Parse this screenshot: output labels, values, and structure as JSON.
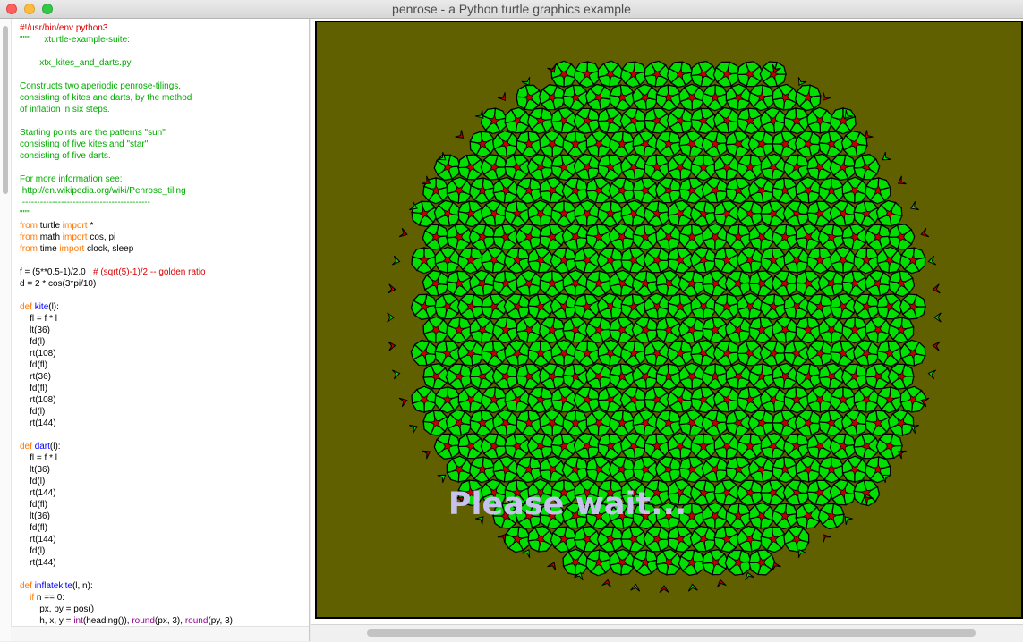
{
  "window": {
    "title": "penrose - a Python turtle graphics example"
  },
  "colors": {
    "canvas_background": "#606000",
    "kite_fill": "#00e000",
    "dart_fill": "#c00000",
    "outline": "#000000",
    "overlay_text": "#c6c2ee",
    "code_keyword": "#ff7700",
    "code_string": "#00aa00",
    "code_comment": "#dd0000",
    "code_defname": "#0000ff",
    "code_builtin": "#900090"
  },
  "editor": {
    "lines": [
      [
        {
          "t": "#!/usr/bin/env python3",
          "c": "cm"
        }
      ],
      [
        {
          "t": "\"\"\"      xturtle-example-suite:",
          "c": "st"
        }
      ],
      [
        {
          "t": "",
          "c": "st"
        }
      ],
      [
        {
          "t": "        xtx_kites_and_darts.py",
          "c": "st"
        }
      ],
      [
        {
          "t": "",
          "c": "st"
        }
      ],
      [
        {
          "t": "Constructs two aperiodic penrose-tilings,",
          "c": "st"
        }
      ],
      [
        {
          "t": "consisting of kites and darts, by the method",
          "c": "st"
        }
      ],
      [
        {
          "t": "of inflation in six steps.",
          "c": "st"
        }
      ],
      [
        {
          "t": "",
          "c": "st"
        }
      ],
      [
        {
          "t": "Starting points are the patterns \"sun\"",
          "c": "st"
        }
      ],
      [
        {
          "t": "consisting of five kites and \"star\"",
          "c": "st"
        }
      ],
      [
        {
          "t": "consisting of five darts.",
          "c": "st"
        }
      ],
      [
        {
          "t": "",
          "c": "st"
        }
      ],
      [
        {
          "t": "For more information see:",
          "c": "st"
        }
      ],
      [
        {
          "t": " http://en.wikipedia.org/wiki/Penrose_tiling",
          "c": "st"
        }
      ],
      [
        {
          "t": " -------------------------------------------",
          "c": "st"
        }
      ],
      [
        {
          "t": "\"\"\"",
          "c": "st"
        }
      ],
      [
        {
          "t": "from",
          "c": "kw"
        },
        {
          "t": " turtle ",
          "c": ""
        },
        {
          "t": "import",
          "c": "kw"
        },
        {
          "t": " *",
          "c": ""
        }
      ],
      [
        {
          "t": "from",
          "c": "kw"
        },
        {
          "t": " math ",
          "c": ""
        },
        {
          "t": "import",
          "c": "kw"
        },
        {
          "t": " cos, pi",
          "c": ""
        }
      ],
      [
        {
          "t": "from",
          "c": "kw"
        },
        {
          "t": " time ",
          "c": ""
        },
        {
          "t": "import",
          "c": "kw"
        },
        {
          "t": " clock, sleep",
          "c": ""
        }
      ],
      [
        {
          "t": "",
          "c": ""
        }
      ],
      [
        {
          "t": "f = (5**0.5-1)/2.0   ",
          "c": ""
        },
        {
          "t": "# (sqrt(5)-1)/2 -- golden ratio",
          "c": "cm"
        }
      ],
      [
        {
          "t": "d = 2 * cos(3*pi/10)",
          "c": ""
        }
      ],
      [
        {
          "t": "",
          "c": ""
        }
      ],
      [
        {
          "t": "def",
          "c": "kw"
        },
        {
          "t": " ",
          "c": ""
        },
        {
          "t": "kite",
          "c": "df"
        },
        {
          "t": "(l):",
          "c": ""
        }
      ],
      [
        {
          "t": "    fl = f * l",
          "c": ""
        }
      ],
      [
        {
          "t": "    lt(36)",
          "c": ""
        }
      ],
      [
        {
          "t": "    fd(l)",
          "c": ""
        }
      ],
      [
        {
          "t": "    rt(108)",
          "c": ""
        }
      ],
      [
        {
          "t": "    fd(fl)",
          "c": ""
        }
      ],
      [
        {
          "t": "    rt(36)",
          "c": ""
        }
      ],
      [
        {
          "t": "    fd(fl)",
          "c": ""
        }
      ],
      [
        {
          "t": "    rt(108)",
          "c": ""
        }
      ],
      [
        {
          "t": "    fd(l)",
          "c": ""
        }
      ],
      [
        {
          "t": "    rt(144)",
          "c": ""
        }
      ],
      [
        {
          "t": "",
          "c": ""
        }
      ],
      [
        {
          "t": "def",
          "c": "kw"
        },
        {
          "t": " ",
          "c": ""
        },
        {
          "t": "dart",
          "c": "df"
        },
        {
          "t": "(l):",
          "c": ""
        }
      ],
      [
        {
          "t": "    fl = f * l",
          "c": ""
        }
      ],
      [
        {
          "t": "    lt(36)",
          "c": ""
        }
      ],
      [
        {
          "t": "    fd(l)",
          "c": ""
        }
      ],
      [
        {
          "t": "    rt(144)",
          "c": ""
        }
      ],
      [
        {
          "t": "    fd(fl)",
          "c": ""
        }
      ],
      [
        {
          "t": "    lt(36)",
          "c": ""
        }
      ],
      [
        {
          "t": "    fd(fl)",
          "c": ""
        }
      ],
      [
        {
          "t": "    rt(144)",
          "c": ""
        }
      ],
      [
        {
          "t": "    fd(l)",
          "c": ""
        }
      ],
      [
        {
          "t": "    rt(144)",
          "c": ""
        }
      ],
      [
        {
          "t": "",
          "c": ""
        }
      ],
      [
        {
          "t": "def",
          "c": "kw"
        },
        {
          "t": " ",
          "c": ""
        },
        {
          "t": "inflatekite",
          "c": "df"
        },
        {
          "t": "(l, n):",
          "c": ""
        }
      ],
      [
        {
          "t": "    ",
          "c": ""
        },
        {
          "t": "if",
          "c": "kw"
        },
        {
          "t": " n == 0:",
          "c": ""
        }
      ],
      [
        {
          "t": "        px, py = pos()",
          "c": ""
        }
      ],
      [
        {
          "t": "        h, x, y = ",
          "c": ""
        },
        {
          "t": "int",
          "c": "bi"
        },
        {
          "t": "(heading()), ",
          "c": ""
        },
        {
          "t": "round",
          "c": "bi"
        },
        {
          "t": "(px, 3), ",
          "c": ""
        },
        {
          "t": "round",
          "c": "bi"
        },
        {
          "t": "(py, 3)",
          "c": ""
        }
      ]
    ]
  },
  "canvas": {
    "overlay_text": "Please wait...",
    "tiles": {
      "x": [
        [
          -208,
          60
        ],
        [
          -192,
          108
        ],
        [
          -175,
          86
        ],
        [
          -157,
          128
        ],
        [
          -139,
          99
        ],
        [
          -121,
          140
        ],
        [
          -103,
          112
        ],
        [
          -85,
          118
        ],
        [
          -67,
          153
        ],
        [
          -49,
          140
        ],
        [
          -31,
          153
        ],
        [
          -13,
          148
        ],
        [
          5,
          153
        ],
        [
          23,
          148
        ],
        [
          41,
          153
        ],
        [
          59,
          140
        ],
        [
          77,
          153
        ],
        [
          95,
          118
        ],
        [
          113,
          112
        ],
        [
          131,
          140
        ],
        [
          149,
          99
        ],
        [
          167,
          128
        ],
        [
          185,
          86
        ],
        [
          203,
          108
        ],
        [
          221,
          60
        ]
      ]
    }
  }
}
